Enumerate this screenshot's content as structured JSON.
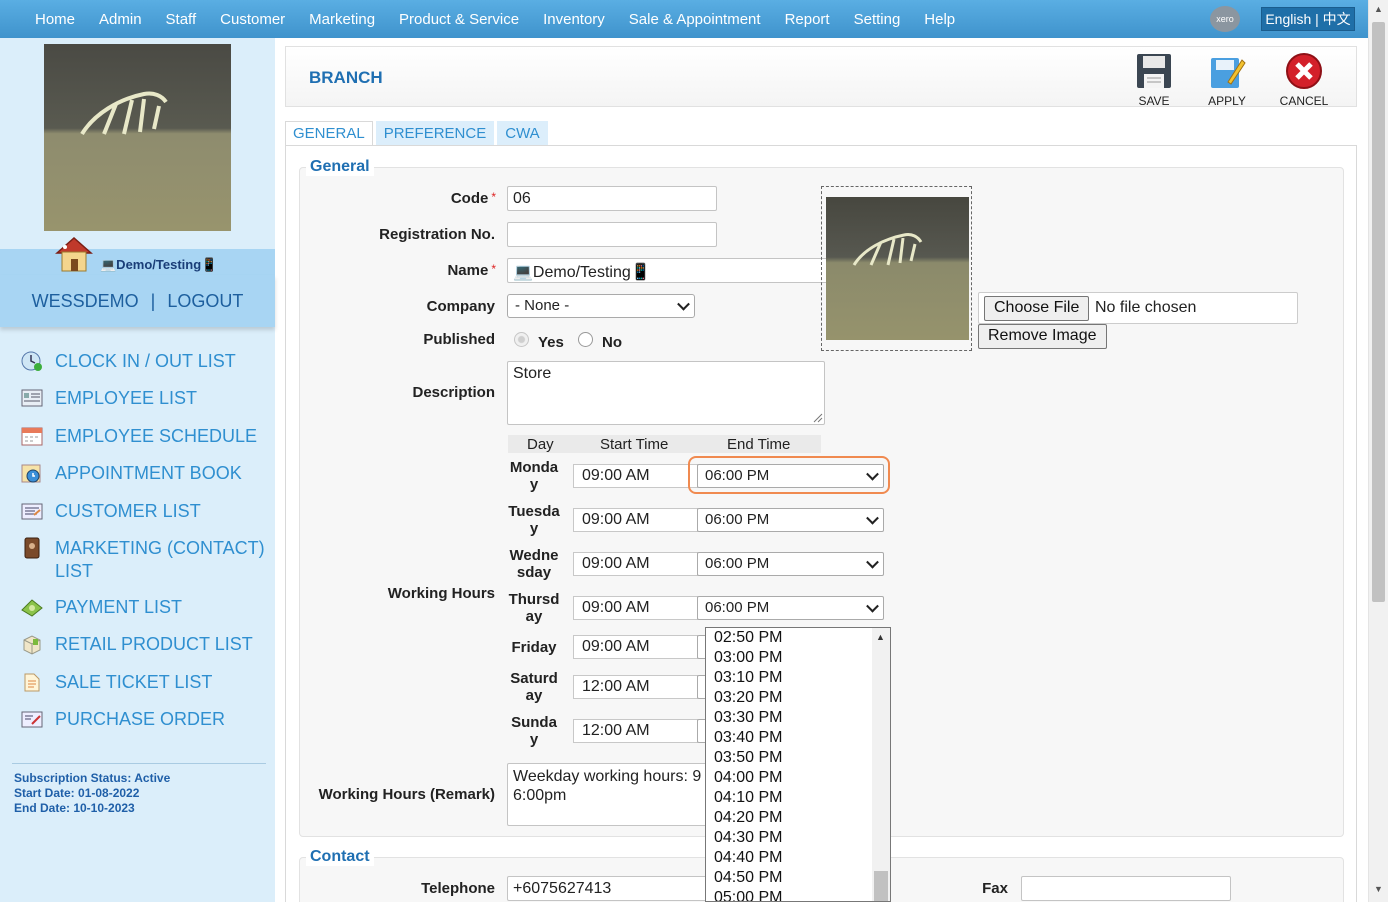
{
  "topnav": {
    "items": [
      "Home",
      "Admin",
      "Staff",
      "Customer",
      "Marketing",
      "Product & Service",
      "Inventory",
      "Sale & Appointment",
      "Report",
      "Setting",
      "Help"
    ],
    "xero_label": "xero",
    "language": "English | 中文"
  },
  "sidebar": {
    "branch_name": "💻Demo/Testing📱",
    "username": "WESSDEMO",
    "separator": "|",
    "logout": "LOGOUT",
    "menu": [
      "CLOCK IN / OUT LIST",
      "EMPLOYEE LIST",
      "EMPLOYEE SCHEDULE",
      "APPOINTMENT BOOK",
      "CUSTOMER LIST",
      "MARKETING (CONTACT) LIST",
      "PAYMENT LIST",
      "RETAIL PRODUCT LIST",
      "SALE TICKET LIST",
      "PURCHASE ORDER"
    ],
    "subscription_status": "Subscription Status: Active",
    "start_date": "Start Date: 01-08-2022",
    "end_date": "End Date: 10-10-2023"
  },
  "header": {
    "title": "BRANCH",
    "save": "SAVE",
    "apply": "APPLY",
    "cancel": "CANCEL"
  },
  "tabs": [
    "GENERAL",
    "PREFERENCE",
    "CWA"
  ],
  "general": {
    "legend": "General",
    "code_label": "Code",
    "code_value": "06",
    "reg_label": "Registration No.",
    "reg_value": "",
    "name_label": "Name",
    "name_value": "💻Demo/Testing📱",
    "company_label": "Company",
    "company_value": "- None -",
    "published_label": "Published",
    "yes": "Yes",
    "no": "No",
    "description_label": "Description",
    "description_value": "Store",
    "choose_file": "Choose File",
    "no_file": "No file chosen",
    "remove_image": "Remove Image",
    "wh_label": "Working Hours",
    "wh_headers": [
      "Day",
      "Start Time",
      "End Time"
    ],
    "days": [
      {
        "day": "Monday",
        "start": "09:00 AM",
        "end": "06:00 PM"
      },
      {
        "day": "Tuesday",
        "start": "09:00 AM",
        "end": "06:00 PM"
      },
      {
        "day": "Wednesday",
        "start": "09:00 AM",
        "end": "06:00 PM"
      },
      {
        "day": "Thursday",
        "start": "09:00 AM",
        "end": "06:00 PM"
      },
      {
        "day": "Friday",
        "start": "09:00 AM",
        "end": ""
      },
      {
        "day": "Saturday",
        "start": "12:00 AM",
        "end": ""
      },
      {
        "day": "Sunday",
        "start": "12:00 AM",
        "end": ""
      }
    ],
    "remark_label": "Working Hours (Remark)",
    "remark_line1": "Weekday working hours: 9",
    "remark_line2": "6:00pm"
  },
  "time_dropdown": [
    "02:50 PM",
    "03:00 PM",
    "03:10 PM",
    "03:20 PM",
    "03:30 PM",
    "03:40 PM",
    "03:50 PM",
    "04:00 PM",
    "04:10 PM",
    "04:20 PM",
    "04:30 PM",
    "04:40 PM",
    "04:50 PM",
    "05:00 PM"
  ],
  "contact": {
    "legend": "Contact",
    "telephone_label": "Telephone",
    "telephone_value": "+6075627413",
    "fax_label": "Fax",
    "fax_value": ""
  },
  "colors": {
    "nav": "#4b9fd6",
    "link": "#2f8fd0",
    "title": "#1f6fb2",
    "highlight": "#f08a50"
  }
}
